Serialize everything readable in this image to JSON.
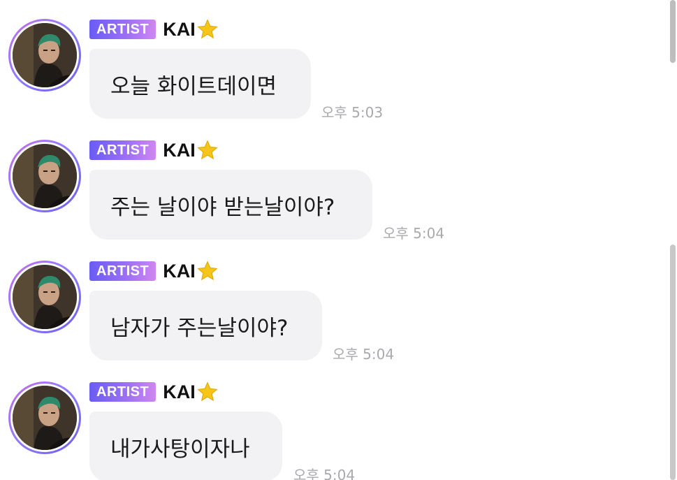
{
  "messages": [
    {
      "badge": "ARTIST",
      "sender": "KAI",
      "text": "오늘 화이트데이면",
      "time": "오후 5:03"
    },
    {
      "badge": "ARTIST",
      "sender": "KAI",
      "text": "주는 날이야 받는날이야?",
      "time": "오후 5:04"
    },
    {
      "badge": "ARTIST",
      "sender": "KAI",
      "text": "남자가 주는날이야?",
      "time": "오후 5:04"
    },
    {
      "badge": "ARTIST",
      "sender": "KAI",
      "text": "내가사탕이자나",
      "time": "오후 5:04"
    }
  ],
  "icons": {
    "star": "star-icon",
    "avatar": "avatar-photo"
  },
  "colors": {
    "badge_start": "#6a5cf5",
    "badge_end": "#cf86f2",
    "bubble_bg": "#f2f2f4",
    "time_text": "#a9a9ae",
    "star": "#f5c518"
  }
}
